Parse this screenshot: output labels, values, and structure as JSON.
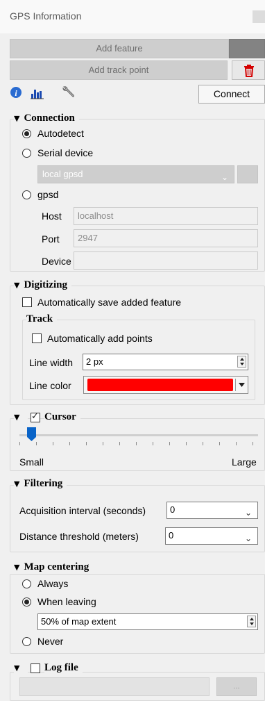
{
  "panel": {
    "title": "GPS Information"
  },
  "toolbar": {
    "add_feature_label": "Add feature",
    "add_track_point_label": "Add track point",
    "connect_label": "Connect",
    "icons": [
      "info-icon",
      "histogram-icon",
      "wrench-icon",
      "trash-icon"
    ]
  },
  "connection": {
    "title": "Connection",
    "autodetect_label": "Autodetect",
    "serial_label": "Serial device",
    "serial_value": "local gpsd",
    "gpsd_label": "gpsd",
    "host_label": "Host",
    "host_value": "localhost",
    "port_label": "Port",
    "port_value": "2947",
    "device_label": "Device",
    "device_value": "",
    "selected": "Autodetect"
  },
  "digitizing": {
    "title": "Digitizing",
    "auto_save_label": "Automatically save added feature",
    "auto_save_checked": false,
    "track_title": "Track",
    "auto_add_points_label": "Automatically add points",
    "auto_add_points_checked": false,
    "line_width_label": "Line width",
    "line_width_value": "2 px",
    "line_color_label": "Line color",
    "line_color": "#ff0000"
  },
  "cursor": {
    "title": "Cursor",
    "enabled": true,
    "min_label": "Small",
    "max_label": "Large",
    "slider_position": 0.05
  },
  "filtering": {
    "title": "Filtering",
    "acq_label": "Acquisition interval (seconds)",
    "acq_value": "0",
    "dist_label": "Distance threshold (meters)",
    "dist_value": "0"
  },
  "map_centering": {
    "title": "Map centering",
    "always_label": "Always",
    "when_leaving_label": "When leaving",
    "extent_value": "50% of map extent",
    "never_label": "Never",
    "selected": "When leaving"
  },
  "log_file": {
    "title": "Log file",
    "enabled": false,
    "path_value": "",
    "browse_label": "..."
  },
  "colors": {
    "accent_slider": "#0a64c8",
    "trash_red": "#d40000",
    "info_blue": "#2a6bd1"
  }
}
